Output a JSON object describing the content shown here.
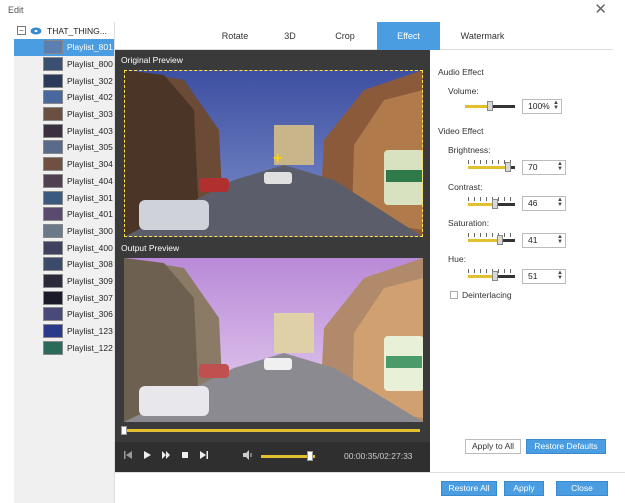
{
  "window": {
    "title": "Edit",
    "close_glyph": "✕"
  },
  "sidebar": {
    "root": {
      "label": "THAT_THING...",
      "toggle": "−"
    },
    "items": [
      {
        "label": "Playlist_801",
        "selected": true
      },
      {
        "label": "Playlist_800"
      },
      {
        "label": "Playlist_302"
      },
      {
        "label": "Playlist_402"
      },
      {
        "label": "Playlist_303"
      },
      {
        "label": "Playlist_403"
      },
      {
        "label": "Playlist_305"
      },
      {
        "label": "Playlist_304"
      },
      {
        "label": "Playlist_404"
      },
      {
        "label": "Playlist_301"
      },
      {
        "label": "Playlist_401"
      },
      {
        "label": "Playlist_300"
      },
      {
        "label": "Playlist_400"
      },
      {
        "label": "Playlist_308"
      },
      {
        "label": "Playlist_309"
      },
      {
        "label": "Playlist_307"
      },
      {
        "label": "Playlist_306"
      },
      {
        "label": "Playlist_123"
      },
      {
        "label": "Playlist_122"
      }
    ]
  },
  "tabs": [
    {
      "label": "Rotate"
    },
    {
      "label": "3D"
    },
    {
      "label": "Crop"
    },
    {
      "label": "Effect",
      "active": true
    },
    {
      "label": "Watermark"
    }
  ],
  "preview": {
    "original_label": "Original Preview",
    "output_label": "Output Preview",
    "timecode": "00:00:35/02:27:33",
    "progress": 0.0,
    "volume": 0.9
  },
  "effects": {
    "audio_title": "Audio Effect",
    "volume_label": "Volume:",
    "volume_value": "100%",
    "video_title": "Video Effect",
    "brightness_label": "Brightness:",
    "brightness_value": "70",
    "contrast_label": "Contrast:",
    "contrast_value": "46",
    "saturation_label": "Saturation:",
    "saturation_value": "41",
    "hue_label": "Hue:",
    "hue_value": "51",
    "deinterlacing_label": "Deinterlacing",
    "deinterlacing_checked": false,
    "apply_all_label": "Apply to All",
    "restore_defaults_label": "Restore Defaults"
  },
  "footer": {
    "restore_all_label": "Restore All",
    "apply_label": "Apply",
    "close_label": "Close"
  },
  "colors": {
    "accent": "#4a9de0",
    "slider_fill": "#e3c030",
    "preview_bg": "#3a3a3a"
  }
}
